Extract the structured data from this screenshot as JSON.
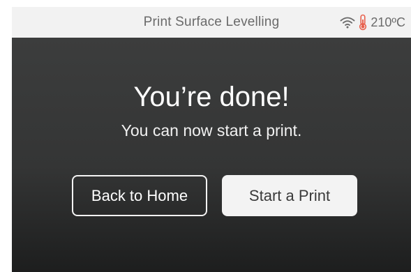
{
  "status_bar": {
    "title": "Print Surface Levelling",
    "wifi_icon": "wifi-icon",
    "thermometer_icon": "thermometer-icon",
    "temperature": "210ºC"
  },
  "main": {
    "headline": "You’re done!",
    "subline": "You can now start a print."
  },
  "buttons": {
    "back_to_home": "Back to Home",
    "start_print": "Start a Print"
  },
  "colors": {
    "thermometer": "#e8604c",
    "background_top": "#3c3d3d",
    "background_bottom": "#1d1e1e"
  }
}
